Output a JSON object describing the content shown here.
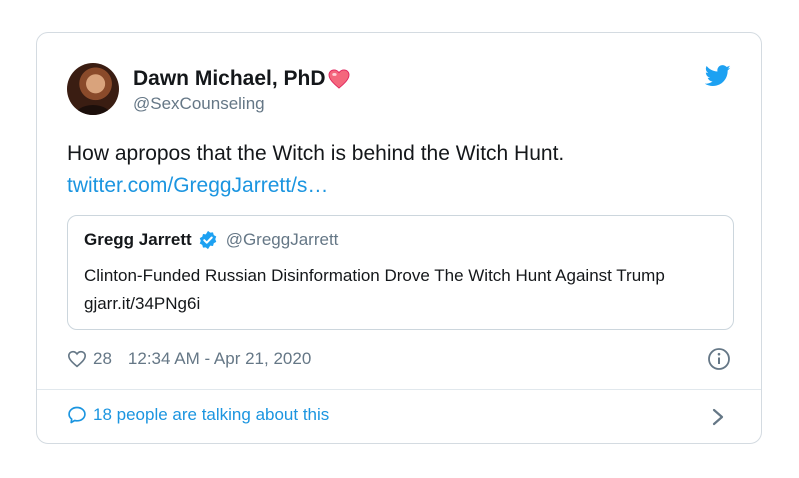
{
  "tweet": {
    "author_name": "Dawn Michael, PhD",
    "author_handle": "@SexCounseling",
    "text": "How apropos that the Witch is behind the Witch Hunt.",
    "link_text": "twitter.com/GreggJarrett/s…",
    "quote": {
      "name": "Gregg Jarrett",
      "handle": "@GreggJarrett",
      "text": "Clinton-Funded Russian Disinformation Drove The Witch Hunt Against Trump gjarr.it/34PNg6i"
    },
    "likes": "28",
    "timestamp": "12:34 AM - Apr 21, 2020",
    "talking": "18 people are talking about this"
  },
  "colors": {
    "accent": "#1da1f2",
    "link": "#1b95e0",
    "muted": "#657786",
    "heart": "#e0245e"
  },
  "icons": [
    "heart-emoji-icon",
    "twitter-bird-icon",
    "verified-badge-icon",
    "like-heart-icon",
    "info-icon",
    "speech-bubble-icon",
    "chevron-right-icon"
  ]
}
